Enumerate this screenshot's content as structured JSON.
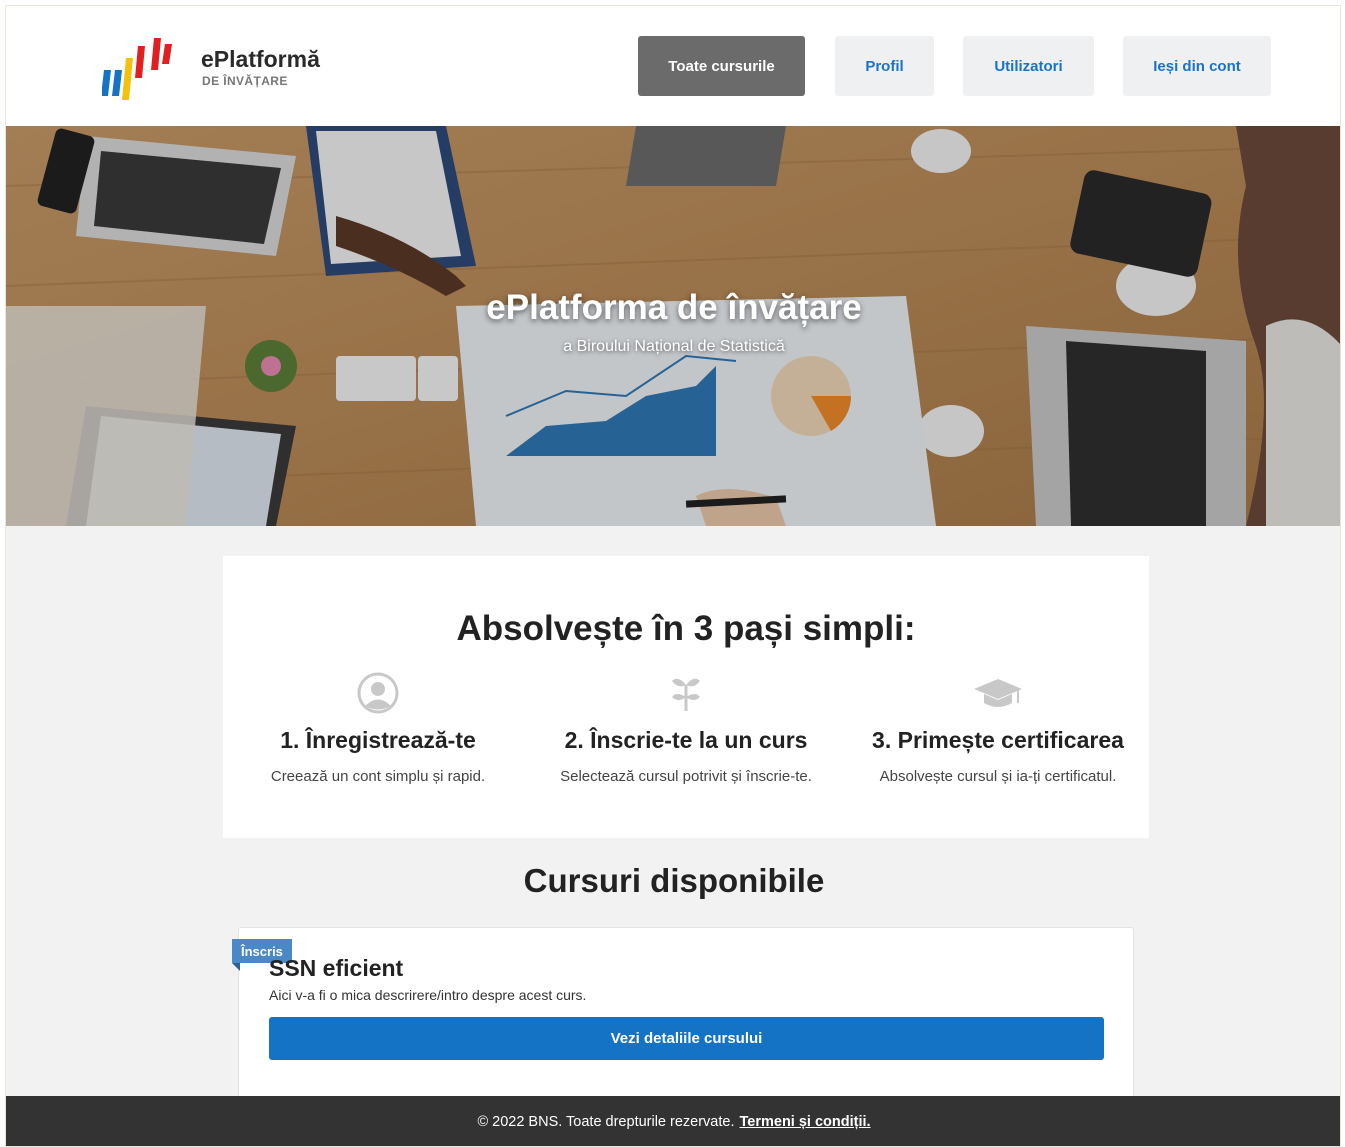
{
  "brand": {
    "name": "ePlatformă",
    "subtitle": "DE ÎNVĂȚARE",
    "colors": {
      "blue": "#1573c5",
      "yellow": "#f4c20d",
      "red": "#e02020"
    }
  },
  "nav": {
    "items": [
      {
        "label": "Toate cursurile",
        "active": true
      },
      {
        "label": "Profil",
        "active": false
      },
      {
        "label": "Utilizatori",
        "active": false
      },
      {
        "label": "Ieși din cont",
        "active": false
      }
    ]
  },
  "hero": {
    "title": "ePlatforma de învățare",
    "subtitle": "a Biroului Național de Statistică",
    "image": "office-desk-business-charts-photo"
  },
  "steps": {
    "title": "Absolvește în 3 pași simpli:",
    "items": [
      {
        "icon": "user-icon",
        "title": "1. Înregistrează-te",
        "desc": "Creează un cont simplu și rapid."
      },
      {
        "icon": "sprout-icon",
        "title": "2. Înscrie-te la un curs",
        "desc": "Selectează cursul potrivit și înscrie-te."
      },
      {
        "icon": "graduation-cap-icon",
        "title": "3. Primește certificarea",
        "desc": "Absolvește cursul și ia-ți certificatul."
      }
    ]
  },
  "courses": {
    "title": "Cursuri disponibile",
    "items": [
      {
        "badge": "Înscris",
        "name": "SSN eficient",
        "desc": "Aici v-a fi o mica descrirere/intro despre acest curs.",
        "button": "Vezi detaliile cursului"
      }
    ]
  },
  "footer": {
    "text": "© 2022 BNS. Toate drepturile rezervate.",
    "link": "Termeni și condiții."
  }
}
